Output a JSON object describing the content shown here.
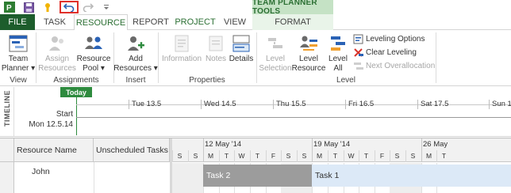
{
  "window": {
    "context_title": "TEAM PLANNER TOOLS"
  },
  "tabs": [
    {
      "label": "FILE"
    },
    {
      "label": "TASK"
    },
    {
      "label": "RESOURCE"
    },
    {
      "label": "REPORT"
    },
    {
      "label": "PROJECT"
    },
    {
      "label": "VIEW"
    },
    {
      "label": "FORMAT"
    }
  ],
  "ribbon": {
    "view": {
      "team_planner_line1": "Team",
      "team_planner_line2": "Planner ▾",
      "group": "View"
    },
    "assignments": {
      "assign_line1": "Assign",
      "assign_line2": "Resources",
      "pool_line1": "Resource",
      "pool_line2": "Pool ▾",
      "group": "Assignments"
    },
    "insert": {
      "add_line1": "Add",
      "add_line2": "Resources ▾",
      "group": "Insert"
    },
    "properties": {
      "information": "Information",
      "notes": "Notes",
      "details": "Details",
      "group": "Properties"
    },
    "level": {
      "level_selection_line1": "Level",
      "level_selection_line2": "Selection",
      "level_resource_line1": "Level",
      "level_resource_line2": "Resource",
      "level_all_line1": "Level",
      "level_all_line2": "All",
      "leveling_options": "Leveling Options",
      "clear_leveling": "Clear Leveling",
      "next_overallocation": "Next Overallocation",
      "group": "Level"
    }
  },
  "timeline": {
    "label": "TIMELINE",
    "today": "Today",
    "ticks": [
      "Tue 13.5",
      "Wed 14.5",
      "Thu 15.5",
      "Fri 16.5",
      "Sat 17.5",
      "Sun 1"
    ],
    "start_label": "Start",
    "start_date": "Mon 12.5.14"
  },
  "grid": {
    "columns": {
      "resource_name": "Resource Name",
      "unscheduled": "Unscheduled Tasks"
    },
    "rows": [
      {
        "name": "John"
      }
    ],
    "weeks": [
      "12 May '14",
      "19 May '14",
      "26 May"
    ],
    "days": [
      "S",
      "S",
      "M",
      "T",
      "W",
      "T",
      "F",
      "S",
      "S",
      "M",
      "T",
      "W",
      "T",
      "F",
      "S",
      "S",
      "M",
      "T"
    ],
    "tasks": [
      {
        "name": "Task 2"
      },
      {
        "name": "Task 1"
      }
    ]
  },
  "colors": {
    "file_tab": "#1d5d2c",
    "accent": "#2e8b3e",
    "context": "#c5e2c5",
    "task_active": "#9c9c9c",
    "task_planned": "#dce9f7"
  }
}
